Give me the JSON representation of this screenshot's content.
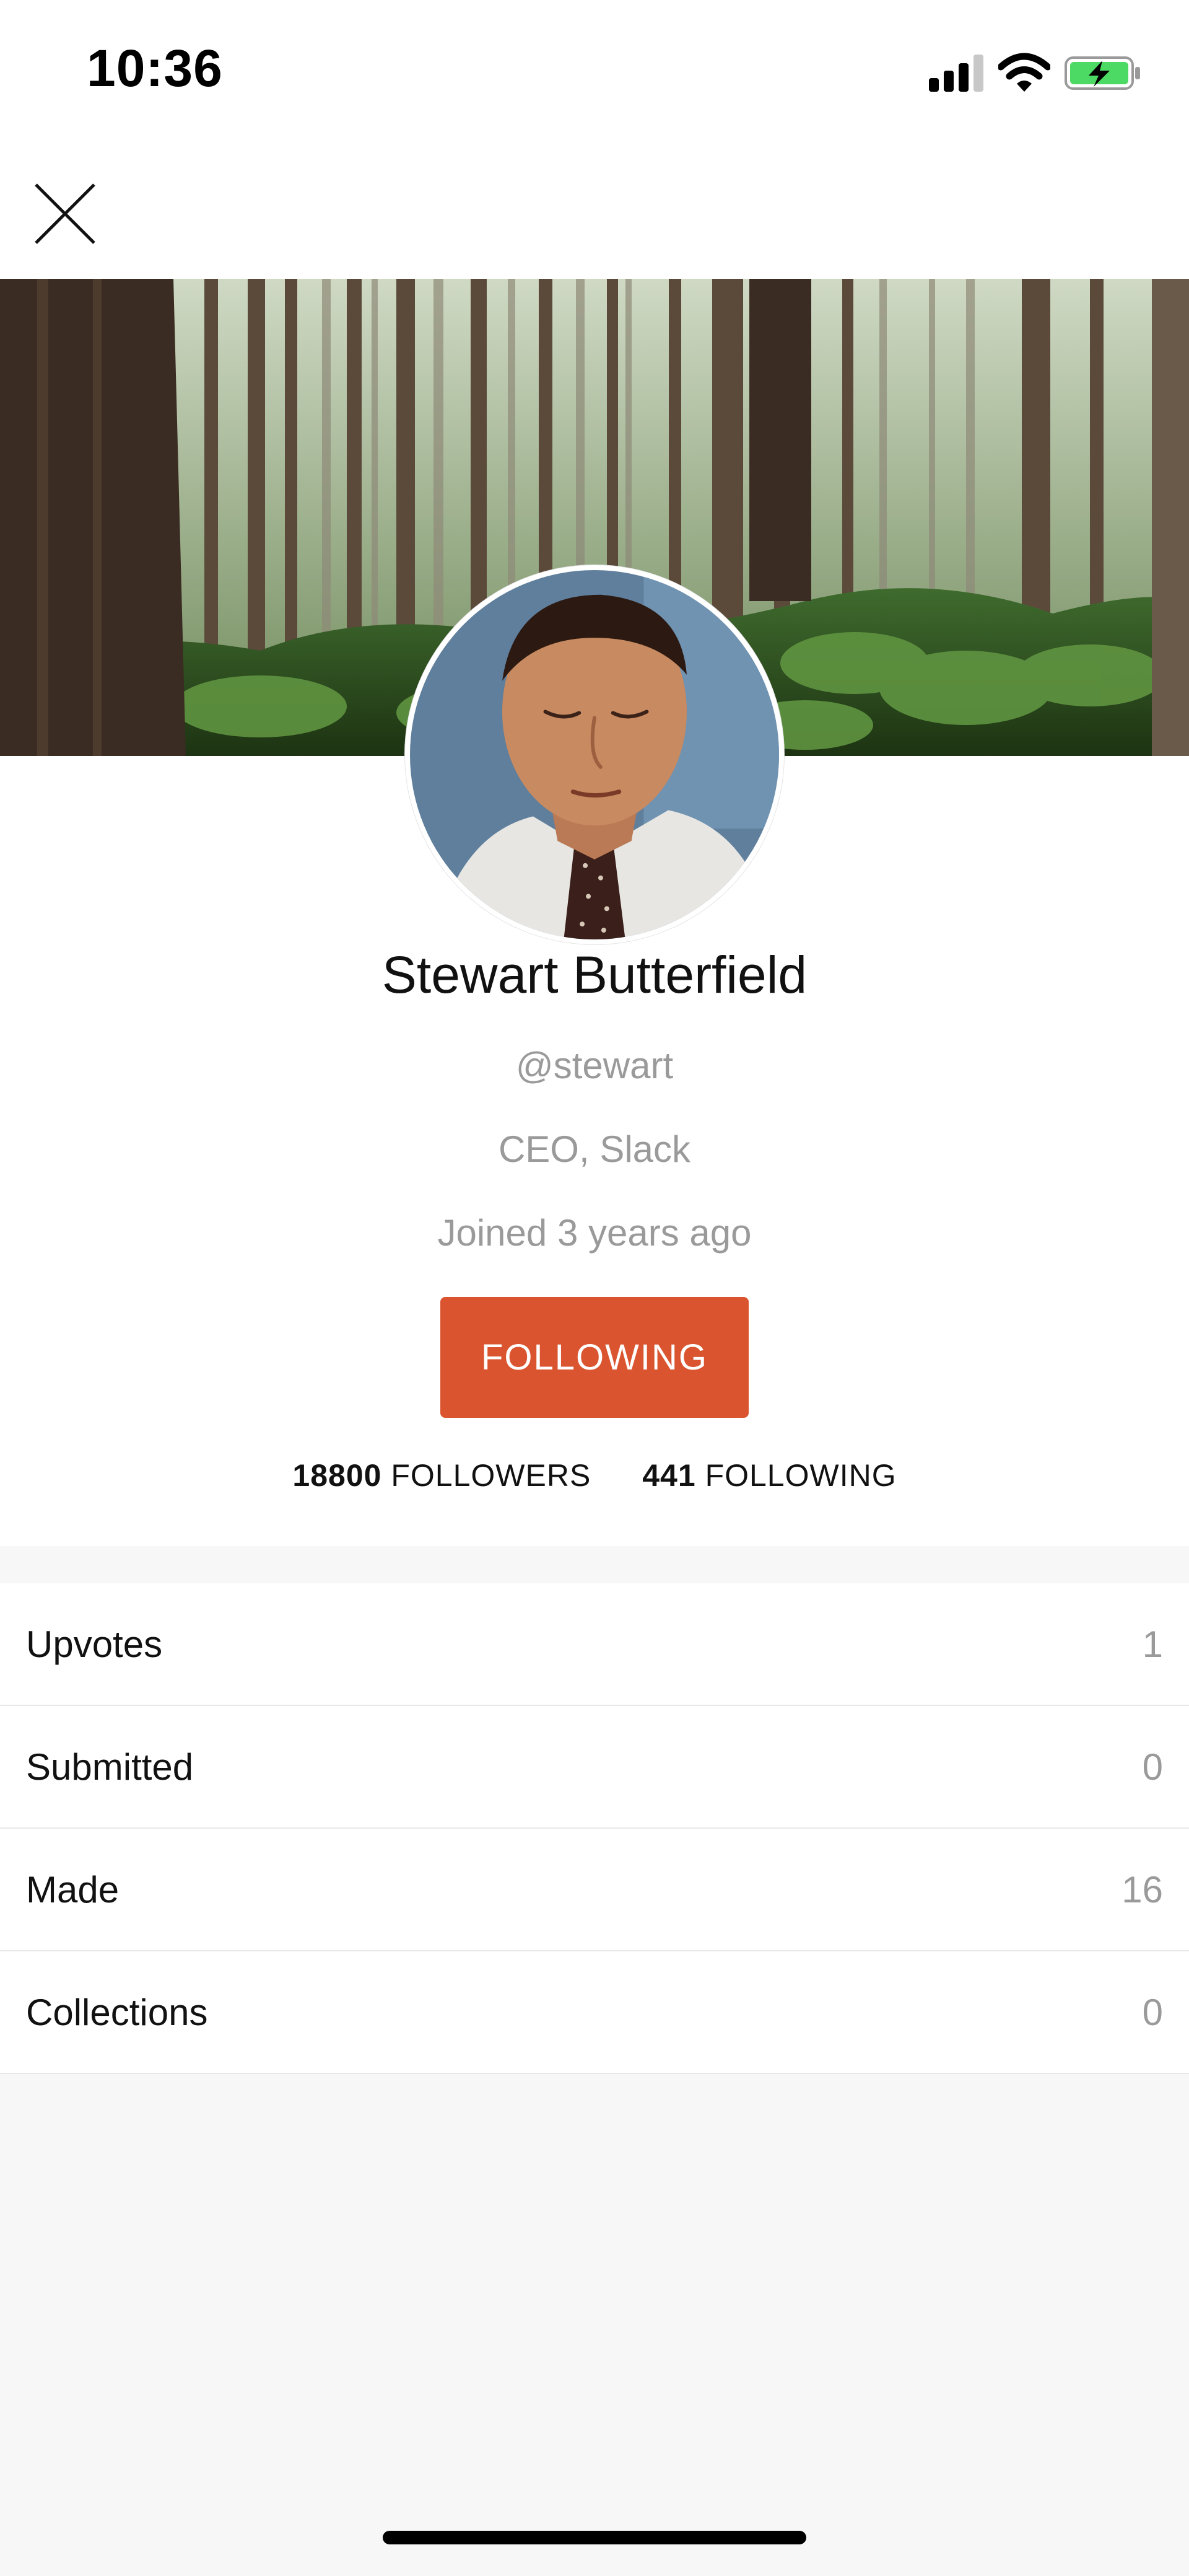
{
  "status_bar": {
    "time": "10:36",
    "signal_icon": "cellular-signal-icon",
    "wifi_icon": "wifi-icon",
    "battery_icon": "battery-charging-icon",
    "battery_color": "#4cd964"
  },
  "header": {
    "close_icon": "close-icon"
  },
  "profile": {
    "name": "Stewart Butterfield",
    "username": "@stewart",
    "headline": "CEO, Slack",
    "joined": "Joined 3 years ago",
    "follow_button_label": "FOLLOWING",
    "followers_count": "18800",
    "followers_label": "FOLLOWERS",
    "following_count": "441",
    "following_label": "FOLLOWING"
  },
  "stats": [
    {
      "label": "Upvotes",
      "value": "1"
    },
    {
      "label": "Submitted",
      "value": "0"
    },
    {
      "label": "Made",
      "value": "16"
    },
    {
      "label": "Collections",
      "value": "0"
    }
  ],
  "colors": {
    "accent": "#da552f",
    "muted_text": "#9a9a9a",
    "background": "#f7f7f7"
  }
}
